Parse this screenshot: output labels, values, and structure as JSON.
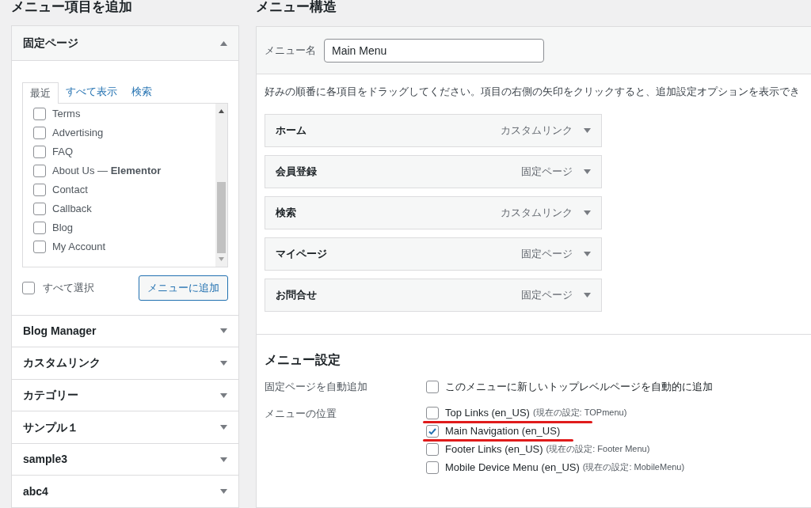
{
  "add_items": {
    "title": "メニュー項目を追加",
    "pages_box": {
      "title": "固定ページ",
      "expanded": true,
      "tabs": [
        {
          "label": "最近",
          "selected": true
        },
        {
          "label": "すべて表示",
          "selected": false
        },
        {
          "label": "検索",
          "selected": false
        }
      ],
      "items": [
        {
          "label": "Terms",
          "checked": false
        },
        {
          "label": "Advertising",
          "checked": false
        },
        {
          "label": "FAQ",
          "checked": false
        },
        {
          "label": "About Us — **Elementor**",
          "checked": false
        },
        {
          "label": "Contact",
          "checked": false
        },
        {
          "label": "Callback",
          "checked": false
        },
        {
          "label": "Blog",
          "checked": false
        },
        {
          "label": "My Account",
          "checked": false
        }
      ],
      "select_all": {
        "label": "すべて選択",
        "checked": false
      },
      "add_button": "メニューに追加"
    },
    "sections": [
      {
        "title": "Blog Manager",
        "expanded": false
      },
      {
        "title": "カスタムリンク",
        "expanded": false
      },
      {
        "title": "カテゴリー",
        "expanded": false
      },
      {
        "title": "サンプル１",
        "expanded": false
      },
      {
        "title": "sample3",
        "expanded": false
      },
      {
        "title": "abc4",
        "expanded": false
      }
    ]
  },
  "structure": {
    "title": "メニュー構造",
    "menu_name": {
      "label": "メニュー名",
      "value": "Main Menu"
    },
    "instructions": "好みの順番に各項目をドラッグしてください。項目の右側の矢印をクリックすると、追加設定オプションを表示でき",
    "items": [
      {
        "title": "ホーム",
        "type": "カスタムリンク"
      },
      {
        "title": "会員登録",
        "type": "固定ページ"
      },
      {
        "title": "検索",
        "type": "カスタムリンク"
      },
      {
        "title": "マイページ",
        "type": "固定ページ"
      },
      {
        "title": "お問合せ",
        "type": "固定ページ"
      }
    ],
    "settings": {
      "title": "メニュー設定",
      "auto_add": {
        "label": "固定ページを自動追加",
        "option": "このメニューに新しいトップレベルページを自動的に追加",
        "checked": false
      },
      "locations_label": "メニューの位置",
      "locations": [
        {
          "label": "Top Links (en_US)",
          "current": "(現在の設定: TOPmenu)",
          "checked": false,
          "underlined": true
        },
        {
          "label": "Main Navigation (en_US)",
          "checked": true,
          "underlined": true
        },
        {
          "label": "Footer Links (en_US)",
          "current": "(現在の設定: Footer Menu)",
          "checked": false,
          "underlined": false
        },
        {
          "label": "Mobile Device Menu (en_US)",
          "current": "(現在の設定: MobileMenu)",
          "checked": false,
          "underlined": false
        }
      ]
    }
  }
}
